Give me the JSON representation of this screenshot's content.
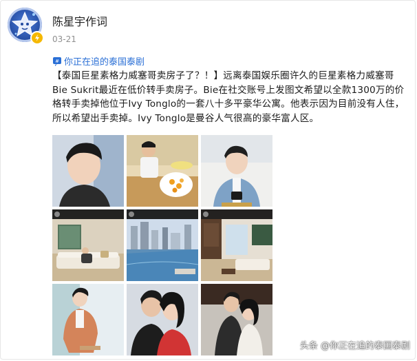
{
  "post": {
    "author": "陈星宇作词",
    "date": "03-21",
    "topic": "你正在追的泰国泰剧",
    "text": "【泰国巨星素格力威塞哥卖房子了？！】远离泰国娱乐圈许久的巨星素格力威塞哥Bie Sukrit最近在低价转手卖房子。Bie在社交账号上发图文希望以全款1300万的价格转手卖掉他位于Ivy Tonglo的一套八十多平豪华公寓。他表示因为目前没有人住，所以希望出手卖掉。Ivy Tonglo是曼谷人气很高的豪华富人区。"
  },
  "images": [
    {
      "name": "photo-portrait-closeup"
    },
    {
      "name": "photo-sitting-with-food"
    },
    {
      "name": "photo-denim-jacket"
    },
    {
      "name": "photo-living-room-sofa"
    },
    {
      "name": "photo-pool-city-view"
    },
    {
      "name": "photo-apartment-living-room"
    },
    {
      "name": "photo-orange-suit"
    },
    {
      "name": "photo-couple-red-dress"
    },
    {
      "name": "photo-couple-formal"
    }
  ],
  "watermark": "头条 @你正在追的泰国泰剧",
  "colors": {
    "link": "#2a6fd6",
    "badge": "#f5b800",
    "muted": "#8f8f8f"
  },
  "icons": {
    "topic": "hashtag-bubble-icon",
    "verified": "verified-badge-icon"
  }
}
